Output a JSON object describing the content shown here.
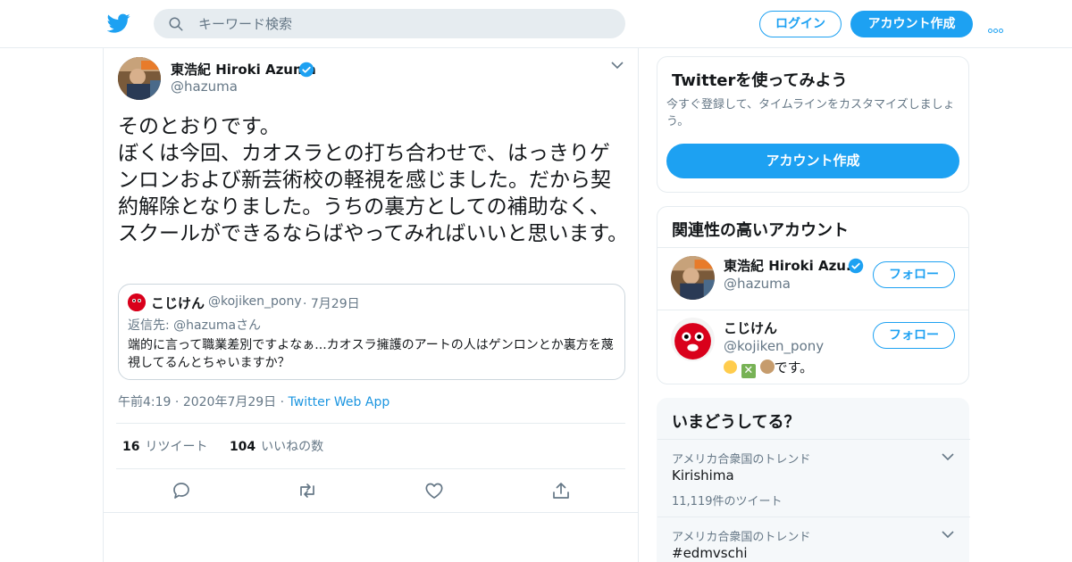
{
  "header": {
    "search_placeholder": "キーワード検索",
    "login_label": "ログイン",
    "signup_label": "アカウント作成",
    "brand_color": "#1da1f2"
  },
  "tweet": {
    "author_name": "東浩紀 Hiroki Azuma",
    "author_handle": "@hazuma",
    "verified": true,
    "text": "そのとおりです。\nぼくは今回、カオスラとの打ち合わせで、はっきりゲンロンおよび新芸術校の軽視を感じました。だから契約解除となりました。うちの裏方としての補助なく、スクールができるならばやってみればいいと思います。",
    "quote": {
      "author_name": "こじけん",
      "author_handle": "@kojiken_pony",
      "date": "· 7月29日",
      "reply_prefix": "返信先: ",
      "reply_to": "@hazumaさん",
      "text": "端的に言って職業差別ですよなぁ...カオスラ擁護のアートの人はゲンロンとか裏方を蔑視してるんとちゃいますか？"
    },
    "time": "午前4:19",
    "date": "2020年7月29日",
    "source": "Twitter Web App",
    "sep": "·",
    "retweet_count": "16",
    "retweet_label": "リツイート",
    "like_count": "104",
    "like_label": "いいねの数",
    "actions": [
      "reply-icon",
      "retweet-icon",
      "like-icon",
      "share-icon"
    ]
  },
  "sidebar": {
    "signup_card": {
      "title": "Twitterを使ってみよう",
      "description": "今すぐ登録して、タイムラインをカスタマイズしましょう。",
      "button_label": "アカウント作成"
    },
    "related": {
      "title": "関連性の高いアカウント",
      "follow_label": "フォロー",
      "accounts": [
        {
          "name": "東浩紀 Hiroki Azu...",
          "handle": "@hazuma",
          "verified": true,
          "bio": ""
        },
        {
          "name": "こじけん",
          "handle": "@kojiken_pony",
          "verified": false,
          "bio": "です。",
          "bio_emoji": [
            "person-emoji",
            "cross-mark-emoji",
            "dog-emoji"
          ]
        }
      ]
    },
    "trends": {
      "title": "いまどうしてる？",
      "items": [
        {
          "location": "アメリカ合衆国のトレンド",
          "name": "Kirishima",
          "count": "11,119件のツイート"
        },
        {
          "location": "アメリカ合衆国のトレンド",
          "name": "#edmvschi",
          "count": ""
        }
      ]
    }
  }
}
